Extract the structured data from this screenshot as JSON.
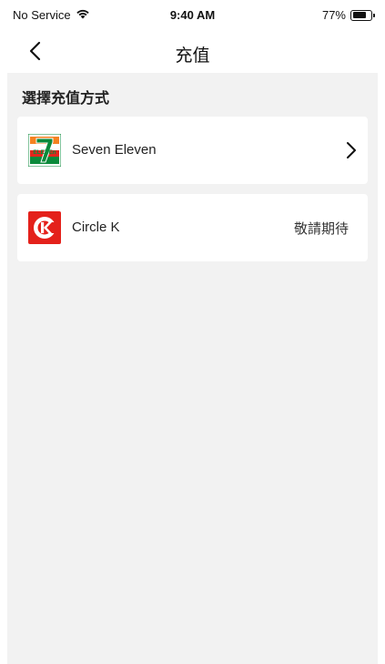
{
  "status_bar": {
    "carrier": "No Service",
    "time": "9:40 AM",
    "battery_text": "77%",
    "battery_level": 0.77
  },
  "nav": {
    "title": "充值",
    "back_icon": "chevron-left-icon"
  },
  "section": {
    "title": "選擇充值方式"
  },
  "options": [
    {
      "label": "Seven Eleven",
      "logo": "seven-eleven-logo",
      "logo_text": "ELEVEn",
      "action_icon": "chevron-right-icon"
    },
    {
      "label": "Circle K",
      "logo": "circle-k-logo",
      "status": "敬請期待"
    }
  ],
  "colors": {
    "background": "#f2f2f2",
    "card": "#ffffff",
    "circle_k_red": "#e4211b",
    "seven_orange": "#f58220",
    "seven_green": "#0b8a3b",
    "seven_red": "#e3261c"
  }
}
